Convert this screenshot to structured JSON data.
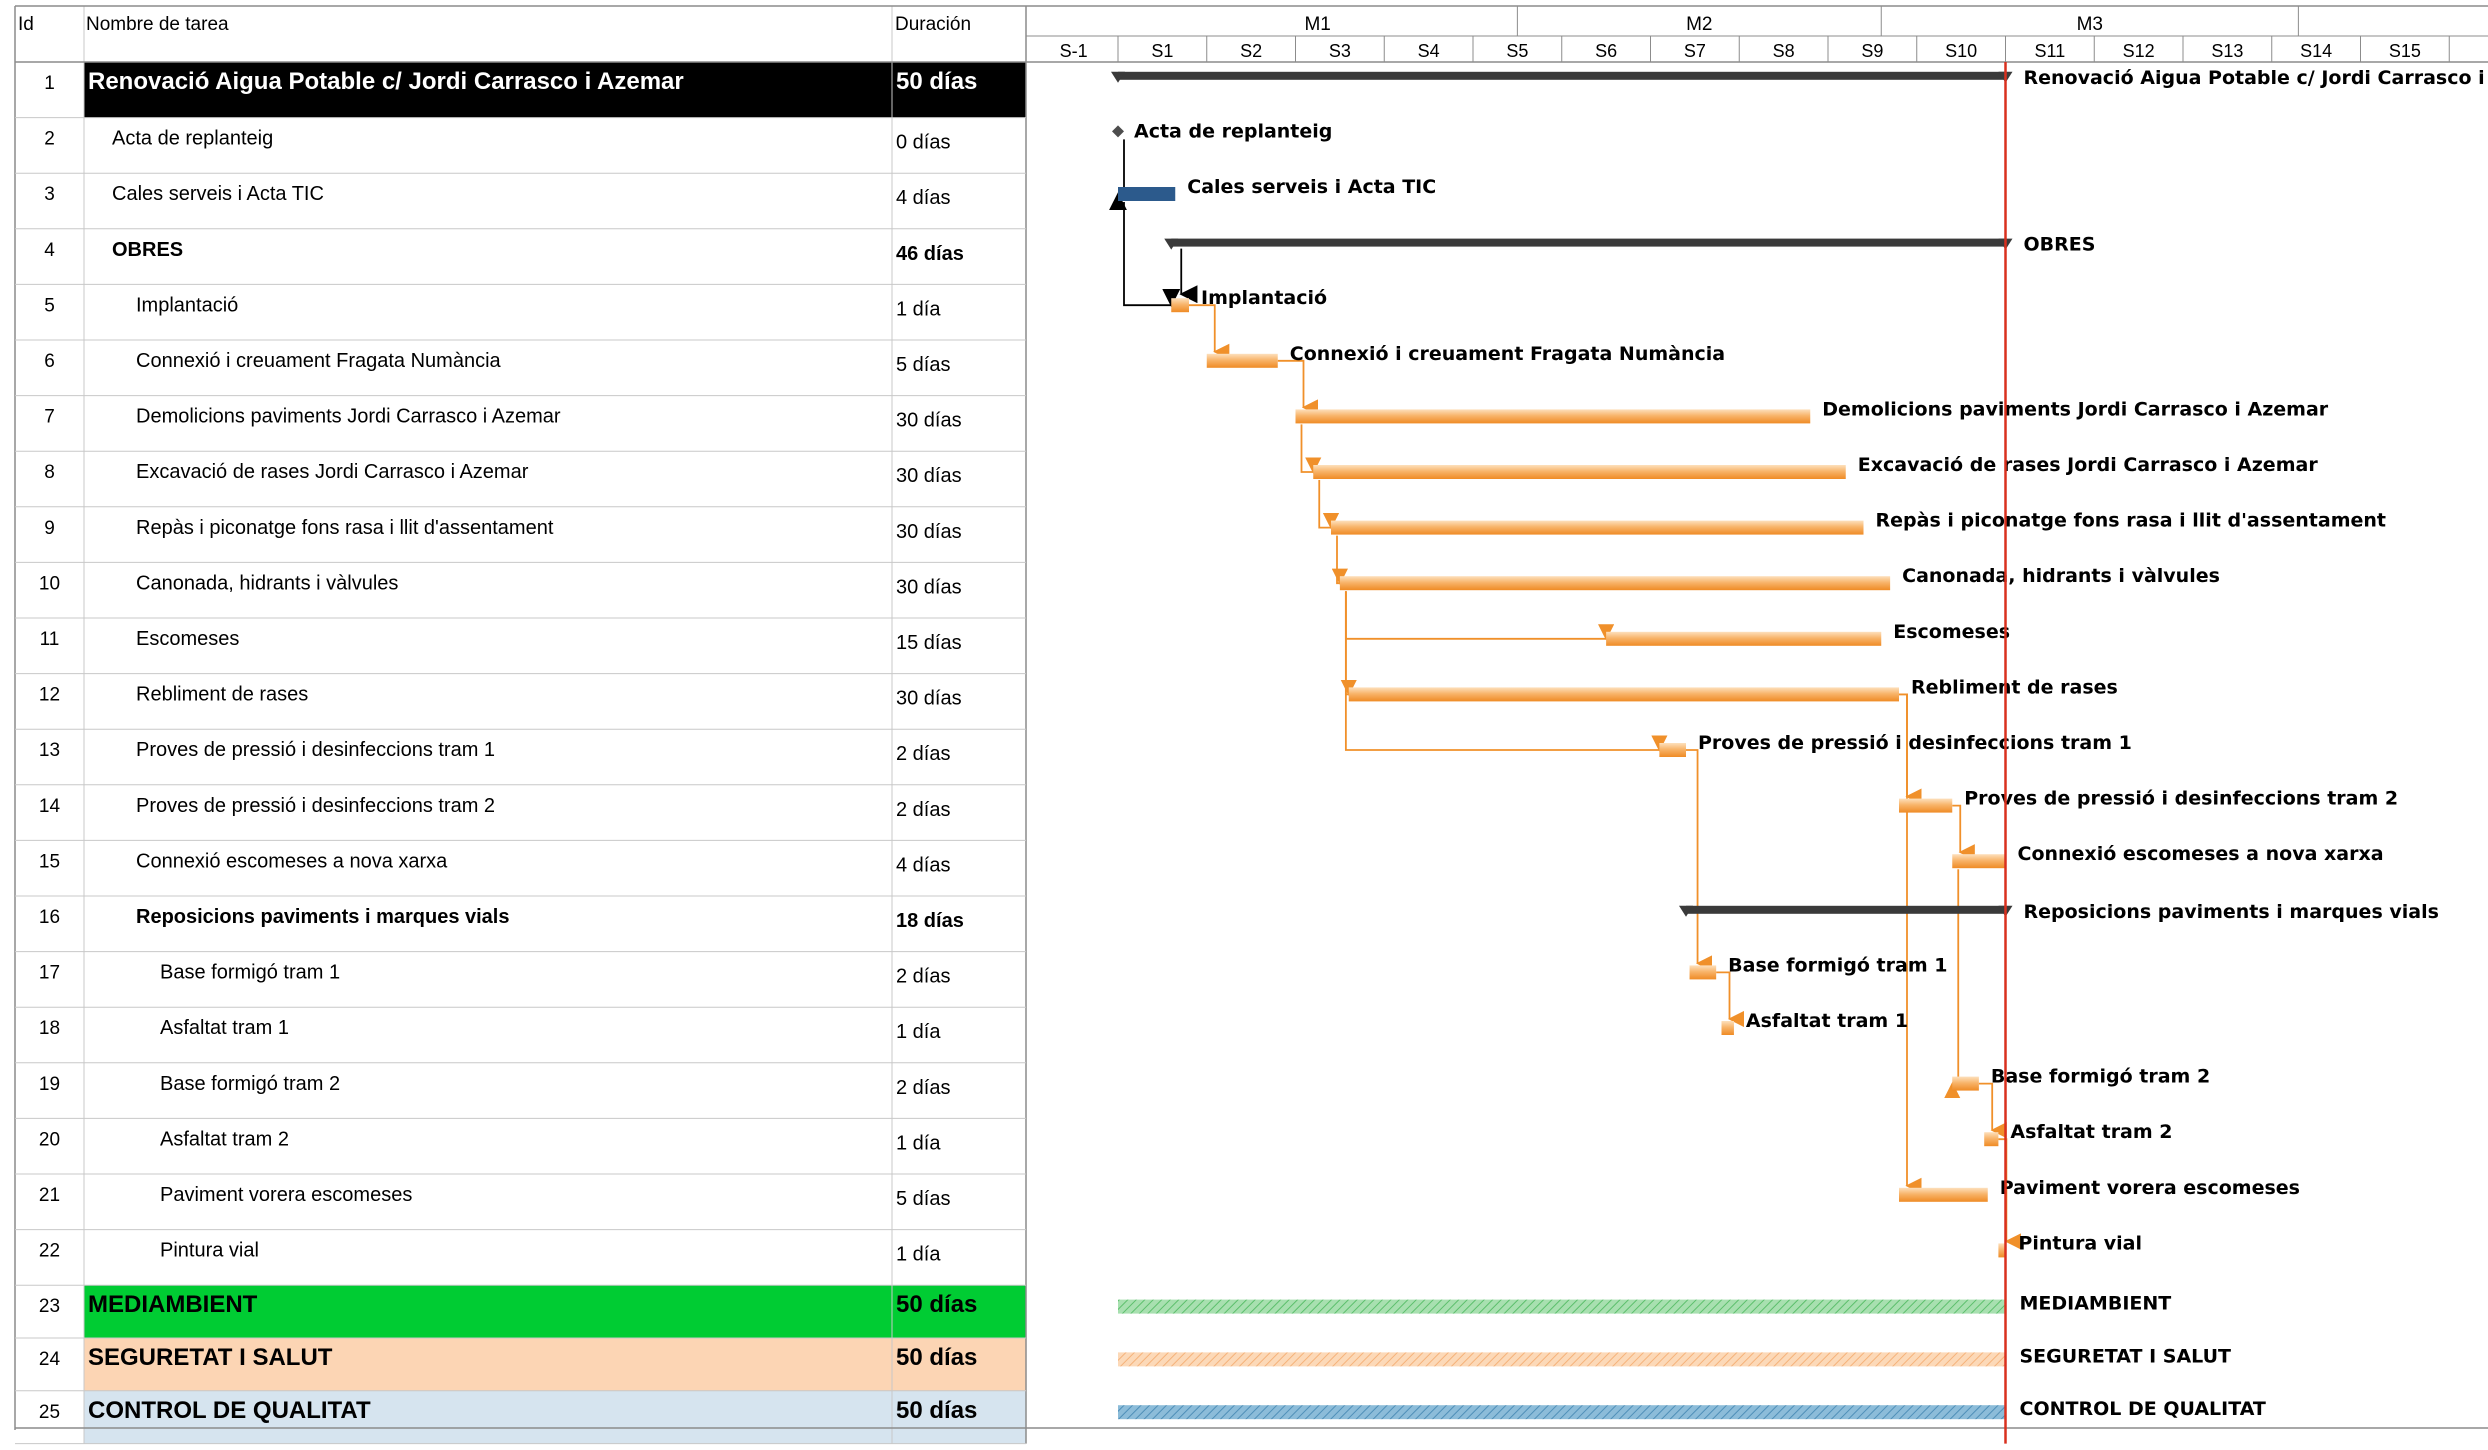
{
  "table": {
    "headers": {
      "id": "Id",
      "name": "Nombre de tarea",
      "duration": "Duración"
    }
  },
  "timescale": {
    "months": [
      "M1",
      "M2",
      "M3"
    ],
    "weeks": [
      "S-1",
      "S1",
      "S2",
      "S3",
      "S4",
      "S5",
      "S6",
      "S7",
      "S8",
      "S9",
      "S10",
      "S11",
      "S12",
      "S13",
      "S14",
      "S15"
    ]
  },
  "colors": {
    "summary_bar": "#3a3a3a",
    "task_bar": "#f5a043",
    "task_bar_light": "#fcd3a6",
    "manual_task_bar": "#2c5a8c",
    "link_line": "#f0902a",
    "current_date_line": "#d9301e",
    "row1_fill": "#000000",
    "mediambient_fill": "#00cc33",
    "mediambient_bar": "#8fd39a",
    "seguretat_fill": "#fcd5b4",
    "seguretat_bar": "#fbc8a0",
    "qualitat_fill": "#d6e4ef",
    "qualitat_bar": "#6aa4c8"
  },
  "tasks": [
    {
      "id": "1",
      "name": "Renovació Aigua Potable c/ Jordi Carrasco i Azemar",
      "duration": "50 días",
      "level": 0,
      "style": "row1",
      "bar": "summary",
      "start": 0,
      "dur": 50,
      "label": "Renovació Aigua Potable c/ Jordi Carrasco i Azemar"
    },
    {
      "id": "2",
      "name": "Acta de replanteig",
      "duration": "0 días",
      "level": 1,
      "style": "normal",
      "bar": "milestone",
      "start": 0,
      "dur": 0,
      "label": "Acta de replanteig"
    },
    {
      "id": "3",
      "name": "Cales serveis i Acta TIC",
      "duration": "4 días",
      "level": 1,
      "style": "normal",
      "bar": "manual",
      "start": 0,
      "dur": 3,
      "label": "Cales serveis i Acta TIC"
    },
    {
      "id": "4",
      "name": "OBRES",
      "duration": "46 días",
      "level": 1,
      "style": "bold",
      "bar": "summary",
      "start": 3,
      "dur": 47,
      "label": "OBRES"
    },
    {
      "id": "5",
      "name": "Implantació",
      "duration": "1 día",
      "level": 2,
      "style": "normal",
      "bar": "task",
      "start": 3,
      "dur": 1,
      "label": "Implantació"
    },
    {
      "id": "6",
      "name": "Connexió i creuament Fragata Numància",
      "duration": "5 días",
      "level": 2,
      "style": "normal",
      "bar": "task",
      "start": 5,
      "dur": 4,
      "label": "Connexió i creuament Fragata Numància"
    },
    {
      "id": "7",
      "name": "Demolicions paviments Jordi Carrasco i Azemar",
      "duration": "30 días",
      "level": 2,
      "style": "normal",
      "bar": "task",
      "start": 10,
      "dur": 29,
      "label": "Demolicions paviments Jordi Carrasco i Azemar"
    },
    {
      "id": "8",
      "name": "Excavació de rases Jordi Carrasco i Azemar",
      "duration": "30 días",
      "level": 2,
      "style": "normal",
      "bar": "task",
      "start": 11,
      "dur": 30,
      "label": "Excavació de rases Jordi Carrasco i Azemar"
    },
    {
      "id": "9",
      "name": "Repàs i piconatge fons rasa i llit d'assentament",
      "duration": "30 días",
      "level": 2,
      "style": "normal",
      "bar": "task",
      "start": 12,
      "dur": 30,
      "label": "Repàs i piconatge fons rasa i llit d'assentament"
    },
    {
      "id": "10",
      "name": "Canonada, hidrants i vàlvules",
      "duration": "30 días",
      "level": 2,
      "style": "normal",
      "bar": "task",
      "start": 12.5,
      "dur": 31,
      "label": "Canonada, hidrants i vàlvules"
    },
    {
      "id": "11",
      "name": "Escomeses",
      "duration": "15 días",
      "level": 2,
      "style": "normal",
      "bar": "task",
      "start": 27.5,
      "dur": 15.5,
      "label": "Escomeses"
    },
    {
      "id": "12",
      "name": "Rebliment de rases",
      "duration": "30 días",
      "level": 2,
      "style": "normal",
      "bar": "task",
      "start": 13,
      "dur": 31,
      "label": "Rebliment de rases"
    },
    {
      "id": "13",
      "name": "Proves de pressió i desinfeccions tram 1",
      "duration": "2 días",
      "level": 2,
      "style": "normal",
      "bar": "task",
      "start": 30.5,
      "dur": 1.5,
      "label": "Proves de pressió i desinfeccions tram 1"
    },
    {
      "id": "14",
      "name": "Proves de pressió i desinfeccions tram 2",
      "duration": "2 días",
      "level": 2,
      "style": "normal",
      "bar": "task",
      "start": 44,
      "dur": 3,
      "label": "Proves de pressió i desinfeccions tram 2"
    },
    {
      "id": "15",
      "name": "Connexió escomeses a nova xarxa",
      "duration": "4 días",
      "level": 2,
      "style": "normal",
      "bar": "task",
      "start": 47,
      "dur": 3,
      "label": "Connexió escomeses a nova xarxa"
    },
    {
      "id": "16",
      "name": "Reposicions paviments i marques vials",
      "duration": "18 días",
      "level": 2,
      "style": "bold",
      "bar": "summary",
      "start": 32,
      "dur": 18,
      "label": "Reposicions paviments i marques vials"
    },
    {
      "id": "17",
      "name": "Base formigó tram 1",
      "duration": "2 días",
      "level": 3,
      "style": "normal",
      "bar": "task",
      "start": 32.2,
      "dur": 1.5,
      "label": "Base formigó tram 1"
    },
    {
      "id": "18",
      "name": "Asfaltat tram 1",
      "duration": "1 día",
      "level": 3,
      "style": "normal",
      "bar": "task",
      "start": 34,
      "dur": 0.7,
      "label": "Asfaltat tram 1"
    },
    {
      "id": "19",
      "name": "Base formigó tram 2",
      "duration": "2 días",
      "level": 3,
      "style": "normal",
      "bar": "task",
      "start": 47,
      "dur": 1.5,
      "label": "Base formigó tram 2"
    },
    {
      "id": "20",
      "name": "Asfaltat tram 2",
      "duration": "1 día",
      "level": 3,
      "style": "normal",
      "bar": "task",
      "start": 48.8,
      "dur": 0.8,
      "label": "Asfaltat tram 2"
    },
    {
      "id": "21",
      "name": "Paviment vorera escomeses",
      "duration": "5 días",
      "level": 3,
      "style": "normal",
      "bar": "task",
      "start": 44,
      "dur": 5,
      "label": "Paviment vorera escomeses"
    },
    {
      "id": "22",
      "name": "Pintura vial",
      "duration": "1 día",
      "level": 3,
      "style": "normal",
      "bar": "task",
      "start": 49.6,
      "dur": 0.4,
      "label": "Pintura vial"
    },
    {
      "id": "23",
      "name": "MEDIAMBIENT",
      "duration": "50 días",
      "level": 0,
      "style": "mediambient",
      "bar": "hatch-green",
      "start": 0,
      "dur": 50,
      "label": "MEDIAMBIENT"
    },
    {
      "id": "24",
      "name": "SEGURETAT I SALUT",
      "duration": "50 días",
      "level": 0,
      "style": "seguretat",
      "bar": "hatch-peach",
      "start": 0,
      "dur": 50,
      "label": "SEGURETAT I SALUT"
    },
    {
      "id": "25",
      "name": "CONTROL DE QUALITAT",
      "duration": "50 días",
      "level": 0,
      "style": "qualitat",
      "bar": "hatch-blue",
      "start": 0,
      "dur": 50,
      "label": "CONTROL DE QUALITAT"
    }
  ],
  "links": [
    [
      2,
      3
    ],
    [
      3,
      5
    ],
    [
      5,
      6
    ],
    [
      6,
      7
    ],
    [
      7,
      8
    ],
    [
      8,
      9
    ],
    [
      9,
      10
    ],
    [
      10,
      11
    ],
    [
      10,
      12
    ],
    [
      10,
      13
    ],
    [
      13,
      17
    ],
    [
      17,
      18
    ],
    [
      12,
      14
    ],
    [
      14,
      15
    ],
    [
      15,
      19
    ],
    [
      19,
      20
    ],
    [
      12,
      21
    ],
    [
      20,
      22
    ]
  ]
}
